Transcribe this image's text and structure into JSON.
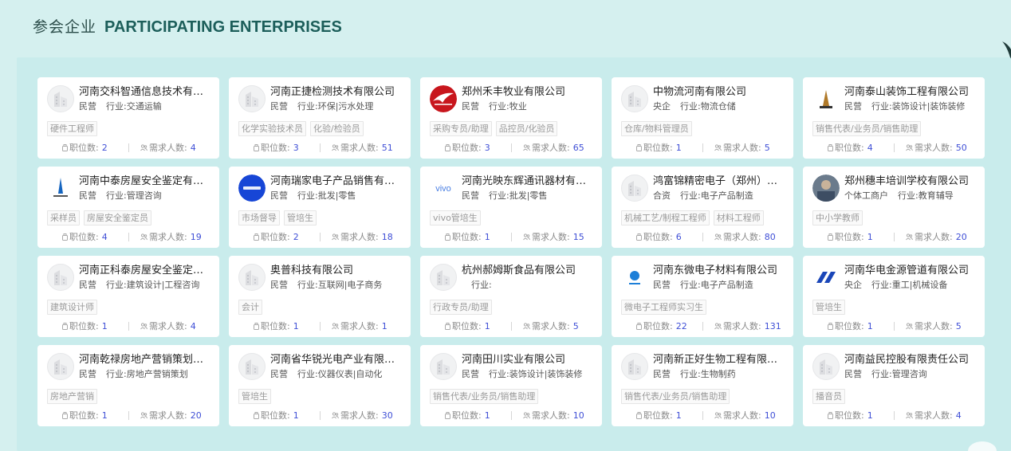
{
  "header": {
    "title_cn": "参会企业",
    "title_en": "PARTICIPATING ENTERPRISES"
  },
  "labels": {
    "positions": "职位数:",
    "demand": "需求人数:",
    "industry": "行业:"
  },
  "colors": {
    "accent_number": "#3f4fd6",
    "background": "#d5f0ef"
  },
  "companies": [
    {
      "name": "河南交科智通信息技术有限公司",
      "type": "民营",
      "industry": "交通运输",
      "tags": [
        "硬件工程师"
      ],
      "positions": "2",
      "demand": "4",
      "logo": "default-building-icon"
    },
    {
      "name": "河南正捷检测技术有限公司",
      "type": "民营",
      "industry": "环保|污水处理",
      "tags": [
        "化学实验技术员",
        "化验/检验员"
      ],
      "positions": "3",
      "demand": "51",
      "logo": "default-building-icon"
    },
    {
      "name": "郑州禾丰牧业有限公司",
      "type": "民营",
      "industry": "牧业",
      "tags": [
        "采购专员/助理",
        "品控员/化验员"
      ],
      "positions": "3",
      "demand": "65",
      "logo": "red-bird-logo"
    },
    {
      "name": "中物流河南有限公司",
      "type": "央企",
      "industry": "物流仓储",
      "tags": [
        "仓库/物料管理员"
      ],
      "positions": "1",
      "demand": "5",
      "logo": "default-building-icon"
    },
    {
      "name": "河南泰山装饰工程有限公司",
      "type": "民营",
      "industry": "装饰设计|装饰装修",
      "tags": [
        "销售代表/业务员/销售助理"
      ],
      "positions": "4",
      "demand": "50",
      "logo": "tower-logo"
    },
    {
      "name": "河南中泰房屋安全鉴定有限公司",
      "type": "民营",
      "industry": "管理咨询",
      "tags": [
        "采样员",
        "房屋安全鉴定员"
      ],
      "positions": "4",
      "demand": "19",
      "logo": "blue-tower-logo"
    },
    {
      "name": "河南瑞家电子产品销售有限公司",
      "type": "民营",
      "industry": "批发|零售",
      "tags": [
        "市场督导",
        "管培生"
      ],
      "positions": "2",
      "demand": "18",
      "logo": "blue-circle-logo"
    },
    {
      "name": "河南光映东辉通讯器材有限公司",
      "type": "民营",
      "industry": "批发|零售",
      "tags": [
        "vivo管培生"
      ],
      "positions": "1",
      "demand": "15",
      "logo": "vivo-logo"
    },
    {
      "name": "鸿富锦精密电子（郑州）有限公司",
      "type": "合资",
      "industry": "电子产品制造",
      "tags": [
        "机械工艺/制程工程师",
        "材料工程师"
      ],
      "positions": "6",
      "demand": "80",
      "logo": "default-building-icon"
    },
    {
      "name": "郑州穗丰培训学校有限公司",
      "type": "个体工商户",
      "industry": "教育辅导",
      "tags": [
        "中小学教师"
      ],
      "positions": "1",
      "demand": "20",
      "logo": "photo-logo"
    },
    {
      "name": "河南正科泰房屋安全鉴定有限公司",
      "type": "民营",
      "industry": "建筑设计|工程咨询",
      "tags": [
        "建筑设计师"
      ],
      "positions": "1",
      "demand": "4",
      "logo": "default-building-icon"
    },
    {
      "name": "奥普科技有限公司",
      "type": "民营",
      "industry": "互联网|电子商务",
      "tags": [
        "会计"
      ],
      "positions": "1",
      "demand": "1",
      "logo": "default-building-icon"
    },
    {
      "name": "杭州郝姆斯食品有限公司",
      "type": "",
      "industry": "",
      "tags": [
        "行政专员/助理"
      ],
      "positions": "1",
      "demand": "5",
      "logo": "default-building-icon"
    },
    {
      "name": "河南东微电子材料有限公司",
      "type": "民营",
      "industry": "电子产品制造",
      "tags": [
        "微电子工程师实习生"
      ],
      "positions": "22",
      "demand": "131",
      "logo": "blue-drop-logo"
    },
    {
      "name": "河南华电金源管道有限公司",
      "type": "央企",
      "industry": "重工|机械设备",
      "tags": [
        "管培生"
      ],
      "positions": "1",
      "demand": "5",
      "logo": "blue-stripes-logo"
    },
    {
      "name": "河南乾禄房地产营销策划有限公司",
      "type": "民营",
      "industry": "房地产营销策划",
      "tags": [
        "房地产营销"
      ],
      "positions": "1",
      "demand": "20",
      "logo": "default-building-icon"
    },
    {
      "name": "河南省华锐光电产业有限公司",
      "type": "民营",
      "industry": "仪器仪表|自动化",
      "tags": [
        "管培生"
      ],
      "positions": "1",
      "demand": "30",
      "logo": "default-building-icon"
    },
    {
      "name": "河南田川实业有限公司",
      "type": "民营",
      "industry": "装饰设计|装饰装修",
      "tags": [
        "销售代表/业务员/销售助理"
      ],
      "positions": "1",
      "demand": "10",
      "logo": "default-building-icon"
    },
    {
      "name": "河南新正好生物工程有限公司",
      "type": "民营",
      "industry": "生物制药",
      "tags": [
        "销售代表/业务员/销售助理"
      ],
      "positions": "1",
      "demand": "10",
      "logo": "default-building-icon"
    },
    {
      "name": "河南益民控股有限责任公司",
      "type": "民营",
      "industry": "管理咨询",
      "tags": [
        "播音员"
      ],
      "positions": "1",
      "demand": "4",
      "logo": "default-building-icon"
    }
  ]
}
